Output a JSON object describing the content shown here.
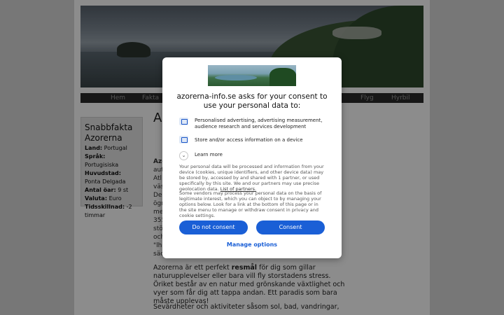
{
  "nav": {
    "items": [
      "Hem",
      "Fakta",
      "Flyg",
      "Hyrbil"
    ]
  },
  "sidebar": {
    "title": "Snabbfakta Azorerna",
    "rows": [
      {
        "label": "Land:",
        "value": "Portugal"
      },
      {
        "label": "Språk:",
        "value": "Portugisiska"
      },
      {
        "label": "Huvudstad:",
        "value": "Ponta Delgada"
      },
      {
        "label": "Antal öar:",
        "value": "9 st"
      },
      {
        "label": "Valuta:",
        "value": "Euro"
      },
      {
        "label": "Tidsskillnad:",
        "value": "-2 timmar"
      }
    ]
  },
  "content": {
    "title_fragment": "Az",
    "snippets": [
      "Azo",
      "aut",
      "Atl",
      "väs",
      "Del",
      "ögr",
      "me",
      "355",
      "stö",
      "och",
      "\"lh",
      "säc"
    ],
    "paragraph1_pre": "Azorerna är ett perfekt ",
    "paragraph1_bold": "resmål",
    "paragraph1_post": " för dig som gillar naturupplevelser eller bara vill fly storstadens stress. Öriket består av en natur med grönskande växtlighet och vyer som får dig att tappa andan. Ett paradis som bara måste upplevas!",
    "paragraph2": "Sevärdheter och aktiviteter såsom sol, bad, vandringar,"
  },
  "consent": {
    "heading": "azorerna-info.se asks for your consent to use your personal data to:",
    "purposes": [
      {
        "icon": "personalised-ads-icon",
        "text": "Personalised advertising, advertising measurement, audience research and services development"
      },
      {
        "icon": "device-storage-icon",
        "text": "Store and/or access information on a device"
      }
    ],
    "learn_more": "Learn more",
    "info1": "Your personal data will be processed and information from your device (cookies, unique identifiers, and other device data) may be stored by, accessed by and shared with 1 partner, or used specifically by this site. We and our partners may use precise geolocation data.",
    "info1_link": "List of partners.",
    "info2": "Some vendors may process your personal data on the basis of legitimate interest, which you can object to by managing your options below. Look for a link at the bottom of this page or in the site menu to manage or withdraw consent in privacy and cookie settings.",
    "do_not_consent": "Do not consent",
    "consent": "Consent",
    "manage_options": "Manage options",
    "accent": "#1a5fd6"
  }
}
